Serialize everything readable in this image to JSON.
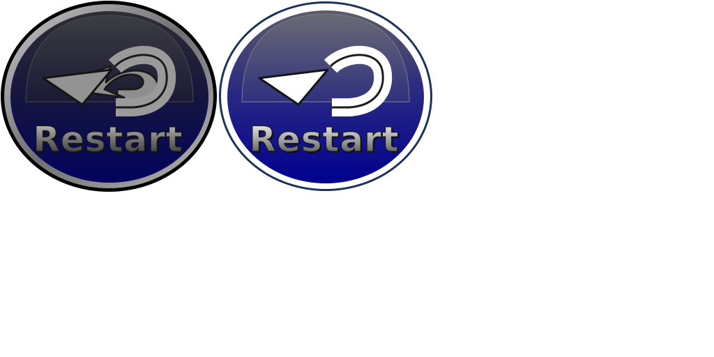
{
  "buttons": [
    {
      "id": "restart-dark",
      "state": "normal",
      "label": "Restart",
      "icon": "restart-arrow-icon",
      "colors": {
        "body_top": "#2e2e33",
        "body_bottom": "#02025e",
        "rim": "#8a8a8e",
        "outline": "#000000"
      }
    },
    {
      "id": "restart-blue",
      "state": "hover",
      "label": "Restart",
      "icon": "restart-arrow-icon",
      "colors": {
        "body_top": "#5a5a66",
        "body_bottom": "#00008f",
        "rim": "#ffffff",
        "outline": "#1c3358"
      }
    }
  ]
}
